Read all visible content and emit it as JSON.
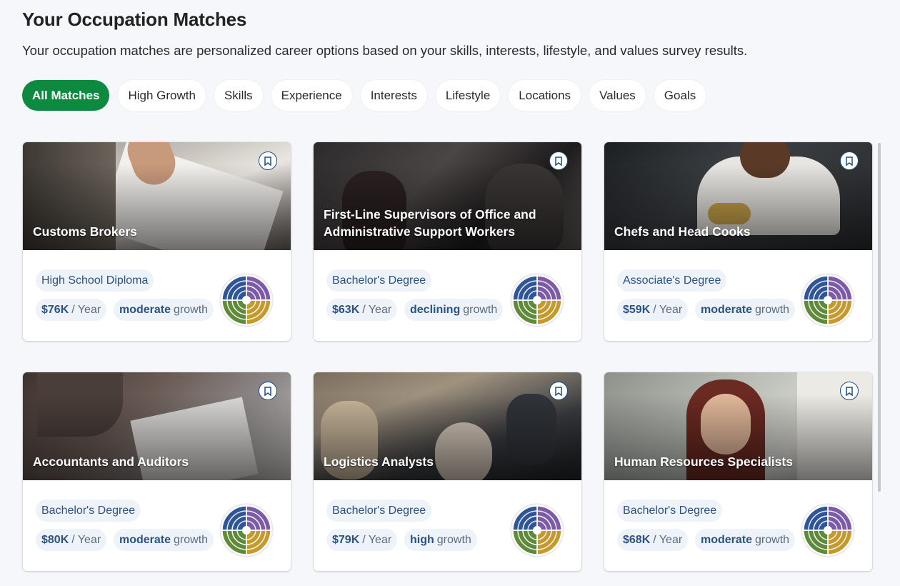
{
  "header": {
    "title": "Your Occupation Matches",
    "subtitle": "Your occupation matches are personalized career options based on your skills, interests, lifestyle, and values survey results."
  },
  "filters": [
    {
      "label": "All Matches",
      "active": true
    },
    {
      "label": "High Growth",
      "active": false
    },
    {
      "label": "Skills",
      "active": false
    },
    {
      "label": "Experience",
      "active": false
    },
    {
      "label": "Interests",
      "active": false
    },
    {
      "label": "Lifestyle",
      "active": false
    },
    {
      "label": "Locations",
      "active": false
    },
    {
      "label": "Values",
      "active": false
    },
    {
      "label": "Goals",
      "active": false
    }
  ],
  "colors": {
    "accent": "#0d8a3f",
    "pill_text": "#2c5282",
    "chart_purple": "#7b5aa6",
    "chart_gold": "#c49a2e",
    "chart_olive": "#5e8a3a",
    "chart_blue": "#2f5597"
  },
  "cards": [
    {
      "title": "Customs Brokers",
      "degree": "High School Diploma",
      "salary": "$76K",
      "salary_unit": "/ Year",
      "growth": "moderate",
      "growth_unit": "growth"
    },
    {
      "title": "First-Line Supervisors of Office and Administrative Support Workers",
      "degree": "Bachelor's Degree",
      "salary": "$63K",
      "salary_unit": "/ Year",
      "growth": "declining",
      "growth_unit": "growth"
    },
    {
      "title": "Chefs and Head Cooks",
      "degree": "Associate's Degree",
      "salary": "$59K",
      "salary_unit": "/ Year",
      "growth": "moderate",
      "growth_unit": "growth"
    },
    {
      "title": "Accountants and Auditors",
      "degree": "Bachelor's Degree",
      "salary": "$80K",
      "salary_unit": "/ Year",
      "growth": "moderate",
      "growth_unit": "growth"
    },
    {
      "title": "Logistics Analysts",
      "degree": "Bachelor's Degree",
      "salary": "$79K",
      "salary_unit": "/ Year",
      "growth": "high",
      "growth_unit": "growth"
    },
    {
      "title": "Human Resources Specialists",
      "degree": "Bachelor's Degree",
      "salary": "$68K",
      "salary_unit": "/ Year",
      "growth": "moderate",
      "growth_unit": "growth"
    }
  ],
  "icons": {
    "bookmark": "bookmark-icon"
  }
}
